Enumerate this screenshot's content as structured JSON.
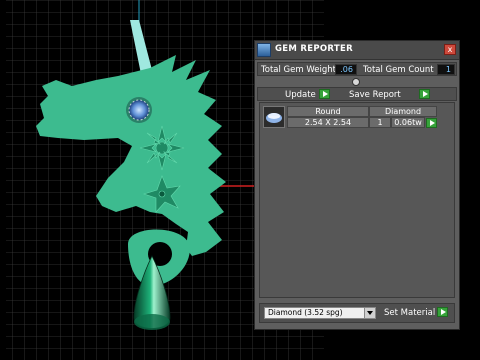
{
  "panel": {
    "title": "GEM REPORTER",
    "close_glyph": "x",
    "total_weight_label": "Total Gem Weight",
    "total_weight_value": ".06",
    "total_count_label": "Total Gem Count",
    "total_count_value": "1",
    "update_label": "Update",
    "save_report_label": "Save Report",
    "table": {
      "shape_header": "Round",
      "material_header": "Diamond",
      "size": "2.54 X 2.54",
      "quantity": "1",
      "weight": "0.06tw"
    },
    "material_select_value": "Diamond   (3.52 spg)",
    "set_material_label": "Set Material"
  },
  "colors": {
    "model": "#3dbb8f",
    "gem_emerald": "#0e8a5e",
    "horn": "#9fe8e0",
    "grid": "#3a3a3a",
    "panel_bg": "#5e5e5e",
    "button_green": "#36a33a"
  }
}
